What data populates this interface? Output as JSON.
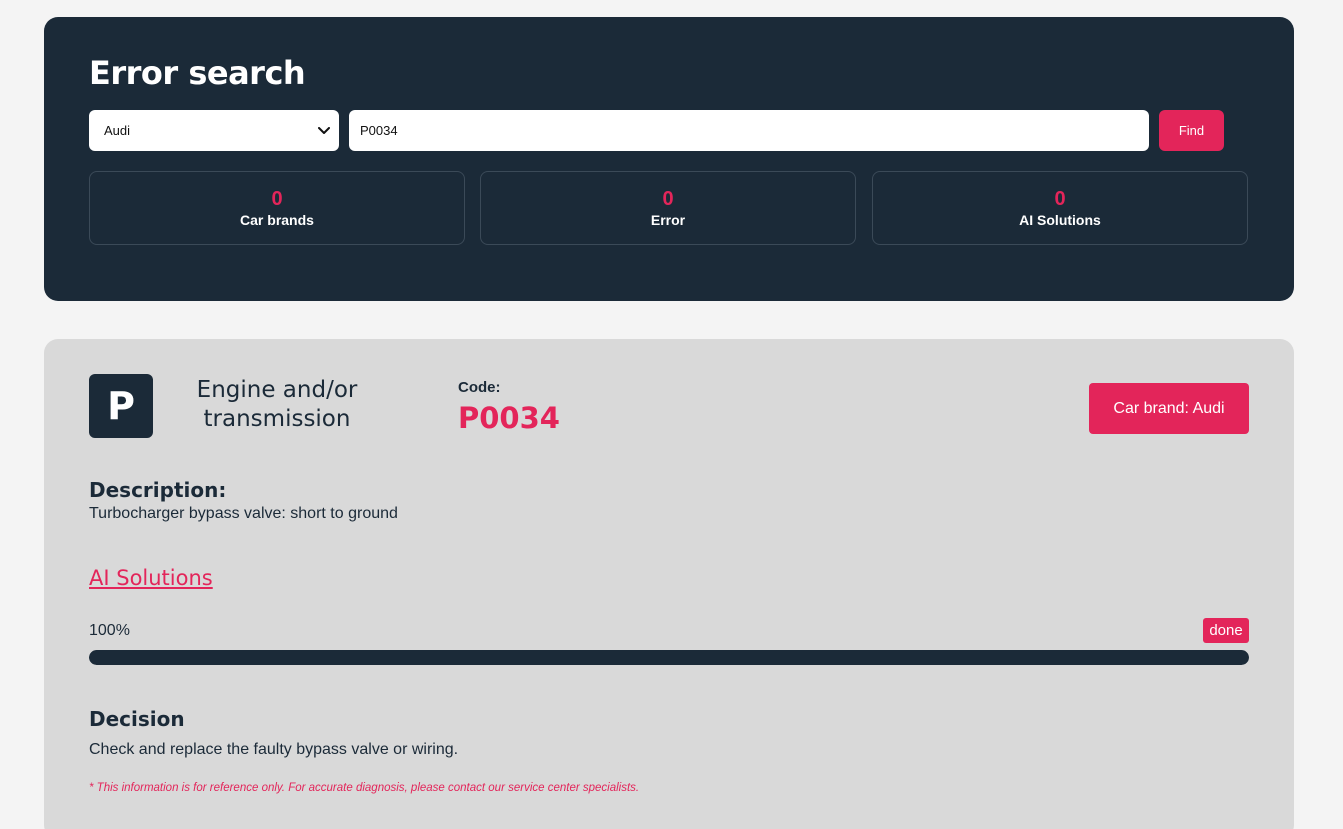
{
  "search": {
    "title": "Error search",
    "brand_selected": "Audi",
    "code_value": "P0034",
    "find_label": "Find"
  },
  "stats": [
    {
      "value": "0",
      "label": "Car brands"
    },
    {
      "value": "0",
      "label": "Error"
    },
    {
      "value": "0",
      "label": "AI Solutions"
    }
  ],
  "result": {
    "category_letter": "P",
    "category_name": "Engine and/or transmission",
    "code_label": "Code:",
    "code": "P0034",
    "brand_tag": "Car brand: Audi",
    "description_heading": "Description:",
    "description": "Turbocharger bypass valve: short to ground",
    "ai_link": "AI Solutions",
    "progress_text": "100%",
    "progress_fraction": 1.0,
    "status_badge": "done",
    "decision_heading": "Decision",
    "decision": "Check and replace the faulty bypass valve or wiring.",
    "disclaimer": "* This information is for reference only. For accurate diagnosis, please contact our service center specialists."
  },
  "colors": {
    "accent": "#e3255a",
    "navy": "#1b2a38",
    "result_bg": "#d9d9d9",
    "page_bg": "#f4f4f4"
  },
  "icons": {
    "select_arrow": "chevron-down-icon"
  }
}
